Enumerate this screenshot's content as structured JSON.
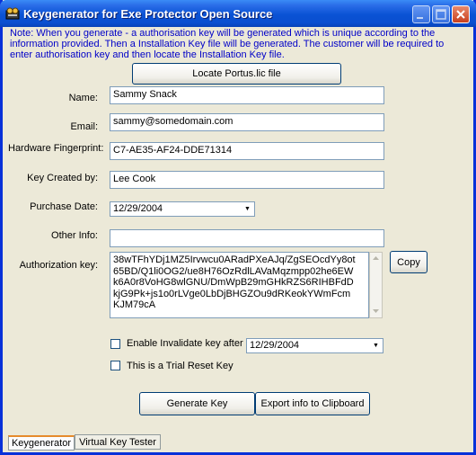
{
  "window": {
    "title": "Keygenerator for Exe Protector Open Source"
  },
  "note": "Note: When you generate - a authorisation key will be generated which is unique according to the information provided. Then a Installation Key file will be generated. The customer will be required to enter authorisation key and then locate the Installation Key file.",
  "buttons": {
    "locate": "Locate Portus.lic file",
    "copy": "Copy",
    "generate": "Generate Key",
    "export": "Export info to Clipboard"
  },
  "form": {
    "name_label": "Name:",
    "name_value": "Sammy Snack",
    "email_label": "Email:",
    "email_value": "sammy@somedomain.com",
    "hw_label": "Hardware Fingerprint:",
    "hw_value": "C7-AE35-AF24-DDE71314",
    "created_label": "Key Created by:",
    "created_value": "Lee Cook",
    "purchase_label": "Purchase Date:",
    "purchase_value": "12/29/2004",
    "other_label": "Other Info:",
    "other_value": "",
    "auth_label": "Authorization key:",
    "auth_value": "38wTFhYDj1MZ5Irvwcu0ARadPXeAJq/ZgSEOcdYy8ot65BD/Q1li0OG2/ue8H76OzRdlLAVaMqzmpp02he6EWk6A0r8VoHG8wlGNU/DmWpB29mGHkRZS6RIHBFdDkjG9Pk+js1o0rLVge0LbDjBHGZOu9dRKeokYWmFcmKJM79cA"
  },
  "options": {
    "invalidate_label": "Enable Invalidate key after",
    "invalidate_date": "12/29/2004",
    "trial_label": "This is a Trial Reset Key"
  },
  "tabs": [
    {
      "label": "Keygenerator"
    },
    {
      "label": "Virtual Key Tester"
    }
  ]
}
